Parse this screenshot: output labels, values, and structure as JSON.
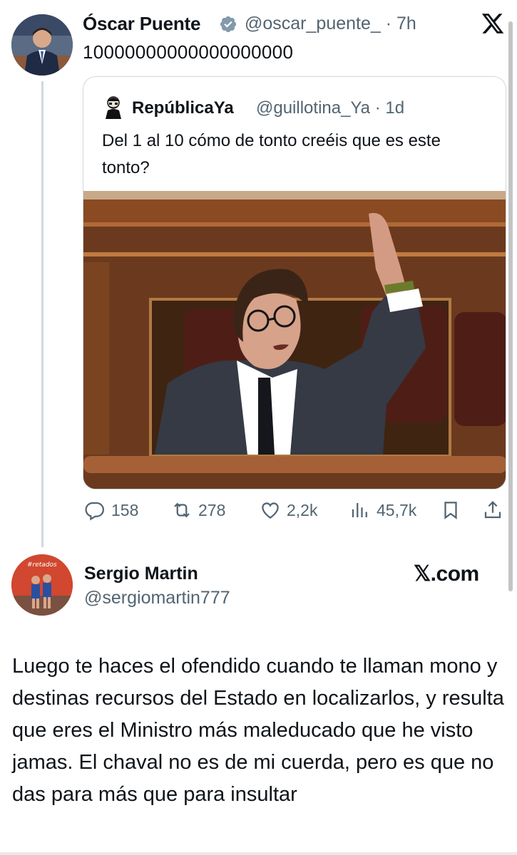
{
  "tweet": {
    "author_name": "Óscar Puente",
    "author_handle": "@oscar_puente_ · 7h",
    "text": "10000000000000000000",
    "quote": {
      "author_name": "RepúblicaYa",
      "author_handle": "@guillotina_Ya · 1d",
      "text": "Del 1 al 10 cómo de tonto creéis que es este tonto?"
    },
    "actions": {
      "replies": "158",
      "retweets": "278",
      "likes": "2,2k",
      "views": "45,7k"
    }
  },
  "card": {
    "author_name": "Sergio Martin",
    "author_handle": "@sergiomartin777",
    "brand": "𝕏.com",
    "avatar_text": "#retados",
    "text": "Luego te haces el ofendido cuando te llaman mono y destinas recursos del Estado en localizarlos, y resulta que eres el Ministro más maleducado que he visto jamas. El chaval no es de mi cuerda, pero es que no das para más que para insultar"
  },
  "colors": {
    "text": "#0f1419",
    "secondary": "#536471",
    "border": "#cfd9de",
    "verified": "#829aab"
  },
  "icons": [
    "x-logo-icon",
    "verified-icon",
    "reply-icon",
    "retweet-icon",
    "like-icon",
    "views-icon",
    "bookmark-icon",
    "share-icon"
  ]
}
